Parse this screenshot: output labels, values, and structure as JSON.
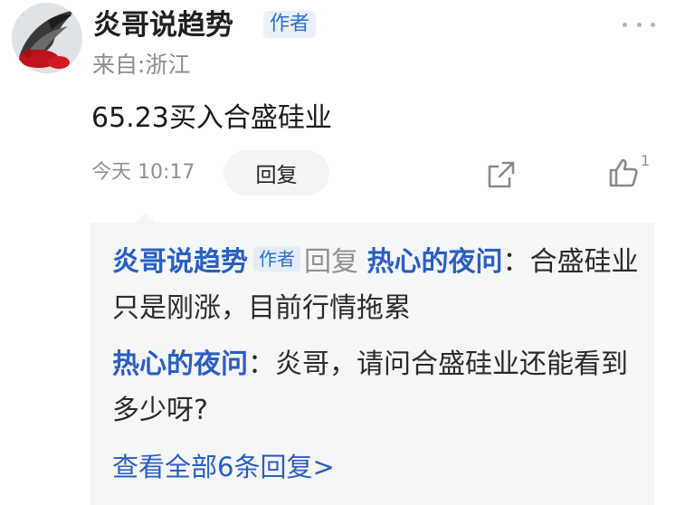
{
  "post": {
    "username": "炎哥说趋势",
    "author_badge": "作者",
    "location": "来自:浙江",
    "content": "65.23买入合盛硅业",
    "time": "今天 10:17",
    "reply_label": "回复",
    "like_count": "1",
    "more_icon": "more-dots-icon",
    "share_icon": "share-icon",
    "like_icon": "thumbs-up-icon"
  },
  "replies": [
    {
      "author": "炎哥说趋势",
      "author_badge": "作者",
      "verb": "回复",
      "target": "热心的夜问",
      "colon": "：",
      "text": "合盛硅业只是刚涨，目前行情拖累"
    },
    {
      "author": "热心的夜问",
      "colon": "：",
      "text": "炎哥，请问合盛硅业还能看到多少呀?"
    }
  ],
  "view_all": "查看全部6条回复>",
  "colors": {
    "accent_blue": "#2a5fc3",
    "badge_bg": "#eaf1fb",
    "reply_bg": "#f5f6f8",
    "muted_gray": "#8f8f8f"
  }
}
